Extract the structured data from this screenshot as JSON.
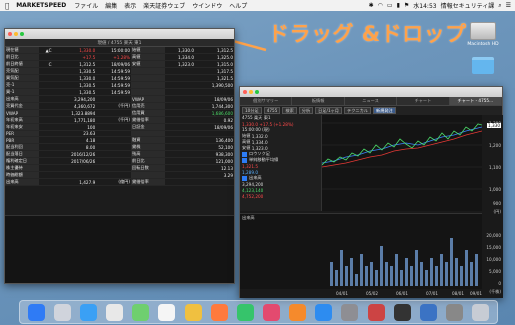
{
  "menubar": {
    "app_name": "MARKETSPEED",
    "items": [
      "ファイル",
      "編集",
      "表示",
      "楽天証券ウェブ",
      "ウインドウ",
      "ヘルプ"
    ],
    "clock": "水14:53",
    "status_text": "情報セキュリティ課"
  },
  "annotation": {
    "text": "ドラッグ &ドロップ"
  },
  "desktop": {
    "drive_label": "Macintosh HD"
  },
  "left_window": {
    "subtitle": "現値 / 4755 楽天 東1",
    "header": [
      "現値",
      "",
      "",
      "",
      "",
      "",
      "前値"
    ],
    "rows": [
      [
        "現在値",
        "▲C",
        "1,330.0",
        "15:00:00",
        "始値",
        "1,330.0",
        "1,312.5"
      ],
      [
        "前日比",
        "",
        "+17.5",
        "+1.28%",
        "高値",
        "1,334.0",
        "1,325.0"
      ],
      [
        "前日終値",
        "C",
        "1,312.5",
        "18/09/06",
        "安値",
        "1,323.0",
        "1,315.0"
      ],
      [
        "売気配",
        "",
        "1,330.5",
        "14:59:59",
        "",
        "",
        "1,317.5"
      ],
      [
        "買気配",
        "",
        "1,330.0",
        "14:59:59",
        "",
        "",
        "1,321.5"
      ],
      [
        "売-1",
        "",
        "1,330.5",
        "14:59:59",
        "",
        "",
        "1,390,500"
      ],
      [
        "買-1",
        "",
        "1,330.5",
        "14:59:59",
        "",
        "",
        ""
      ],
      [
        "出来高",
        "",
        "3,294,200",
        "",
        "VWAP",
        "",
        "18/09/06"
      ],
      [
        "売買代金",
        "",
        "4,360,672",
        "(千円)",
        "信用売",
        "",
        "1,744,300"
      ],
      [
        "VWAP",
        "",
        "1,323.8894",
        "",
        "信用買",
        "",
        "1,686,600"
      ],
      [
        "年初来高",
        "",
        "1,771,180",
        "(千円)",
        "貸借倍率",
        "",
        "0.92"
      ],
      [
        "年初来安",
        "",
        "100",
        "",
        "日証金",
        "",
        "18/09/06"
      ],
      [
        "PER",
        "",
        "23.63",
        "",
        "",
        "",
        ""
      ],
      [
        "PBR",
        "",
        "4.18",
        "",
        "融資",
        "",
        "136,400"
      ],
      [
        "配当利回",
        "",
        "8.00",
        "",
        "貸株",
        "",
        "52,100"
      ],
      [
        "配当落日",
        "",
        "2016/12/26",
        "",
        "残高",
        "",
        "938,300"
      ],
      [
        "権利確定日",
        "",
        "2017/06/26",
        "",
        "前日比",
        "",
        "121,000"
      ],
      [
        "株主優待",
        "",
        "",
        "",
        "回転日数",
        "",
        "12.13"
      ],
      [
        "時価総額",
        "",
        "",
        "",
        "",
        "",
        "3.29"
      ],
      [
        "出来高",
        "",
        "1,427.9",
        "(億円)",
        "貸借倍率",
        "",
        ""
      ]
    ]
  },
  "right_window": {
    "tabs": [
      "個別サマリー",
      "板情報",
      "ニュース",
      "チャート",
      "チャート - 4755..."
    ],
    "toolbar": [
      "10分足",
      "4755",
      "検索",
      "分析",
      "日足/1ヶ月",
      "テクニカル",
      "新規発注"
    ],
    "side": {
      "code": "4755 楽天 東1",
      "time": "15:00:00 (現)",
      "price": "1,330.0",
      "change": "+17.5 (+1.28%)",
      "open_label": "始値",
      "open": "1,332.0",
      "high_label": "高値",
      "high": "1,334.0",
      "low_label": "安値",
      "low": "1,323.0",
      "ind_title": "ロウソク足",
      "ma_title": "単純移動平均線",
      "ma_v1": "1,321.5",
      "ma_v2": "1,289.0",
      "vol_title": "出来高",
      "vol_v1": "3,294,200",
      "vol_v2": "4,123,140",
      "vol_v3": "4,752,200"
    },
    "y_ticks": [
      "1,300",
      "1,200",
      "1,100",
      "1,000",
      "900",
      "(円)"
    ],
    "vol_ticks": [
      "20,000",
      "15,000",
      "10,000",
      "5,000",
      "0",
      "(千株)"
    ],
    "x_ticks": [
      "04/01",
      "05/02",
      "06/01",
      "07/01",
      "08/01",
      "09/01"
    ],
    "price_tag": "1,330",
    "vol_label": "出来高"
  }
}
